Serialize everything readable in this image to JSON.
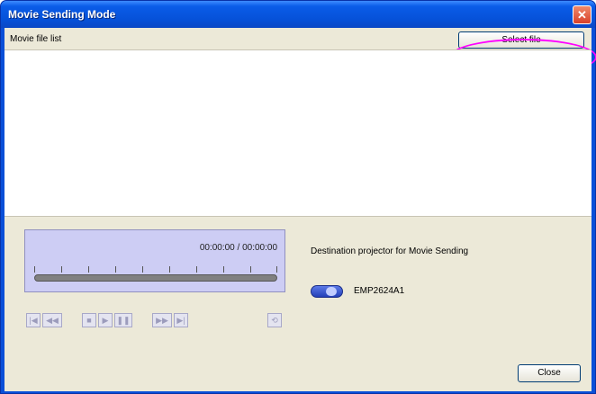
{
  "window": {
    "title": "Movie Sending Mode",
    "close_glyph": "✕"
  },
  "list": {
    "header_label": "Movie file list",
    "select_file_label": "Select file"
  },
  "player": {
    "timecode": "00:00:00 / 00:00:00",
    "controls": [
      {
        "name": "skip-start-icon",
        "glyph": "|◀"
      },
      {
        "name": "rewind-icon",
        "glyph": "◀◀"
      },
      {
        "name": "stop-icon",
        "glyph": "■"
      },
      {
        "name": "play-icon",
        "glyph": "▶"
      },
      {
        "name": "pause-icon",
        "glyph": "❚❚"
      },
      {
        "name": "fast-forward-icon",
        "glyph": "▶▶"
      },
      {
        "name": "skip-end-icon",
        "glyph": "▶|"
      },
      {
        "name": "repeat-icon",
        "glyph": "⟲"
      }
    ]
  },
  "destination": {
    "label": "Destination projector for Movie Sending",
    "projector_name": "EMP2624A1"
  },
  "footer": {
    "close_label": "Close"
  },
  "colors": {
    "titlebar": "#0651d8",
    "client_bg": "#ece9d8",
    "player_bg": "#cdcdf4",
    "highlight": "#ff00ff"
  }
}
